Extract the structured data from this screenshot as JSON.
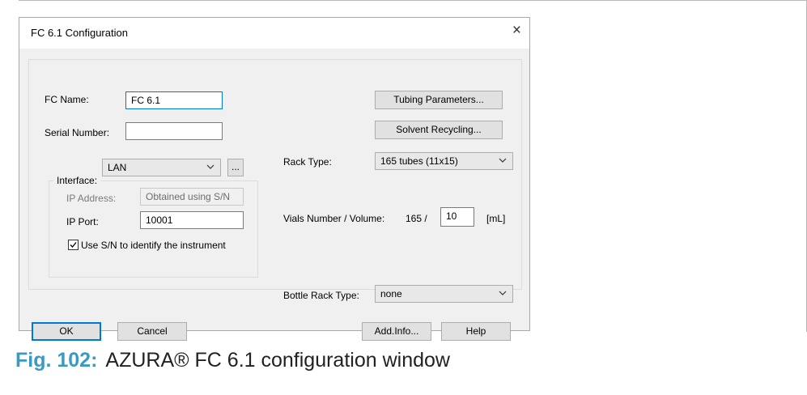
{
  "dialog": {
    "title": "FC 6.1 Configuration",
    "close_glyph": "×",
    "fields": {
      "fc_name_label": "FC Name:",
      "fc_name_value": "FC 6.1",
      "serial_label": "Serial Number:",
      "serial_value": "",
      "interface_label": "Interface:",
      "interface_value": "LAN",
      "browse_label": "...",
      "ip_address_label": "IP Address:",
      "ip_address_value": "Obtained using S/N",
      "ip_port_label": "IP Port:",
      "ip_port_value": "10001",
      "use_sn_label": "Use S/N to identify the instrument",
      "use_sn_checked": true
    },
    "right": {
      "tubing_button": "Tubing Parameters...",
      "solvent_button": "Solvent Recycling...",
      "rack_type_label": "Rack Type:",
      "rack_type_value": "165 tubes (11x15)",
      "vials_label": "Vials Number / Volume:",
      "vials_number": "165 /",
      "vials_volume": "10",
      "vials_unit": "[mL]",
      "bottle_rack_label": "Bottle Rack Type:",
      "bottle_rack_value": "none"
    },
    "buttons": {
      "ok": "OK",
      "cancel": "Cancel",
      "add_info": "Add.Info...",
      "help": "Help"
    }
  },
  "caption": {
    "figure": "Fig. 102:",
    "text": "AZURA® FC 6.1 configuration window"
  },
  "colors": {
    "accent": "#0078d7",
    "caption_figure": "#3a9ac2"
  }
}
